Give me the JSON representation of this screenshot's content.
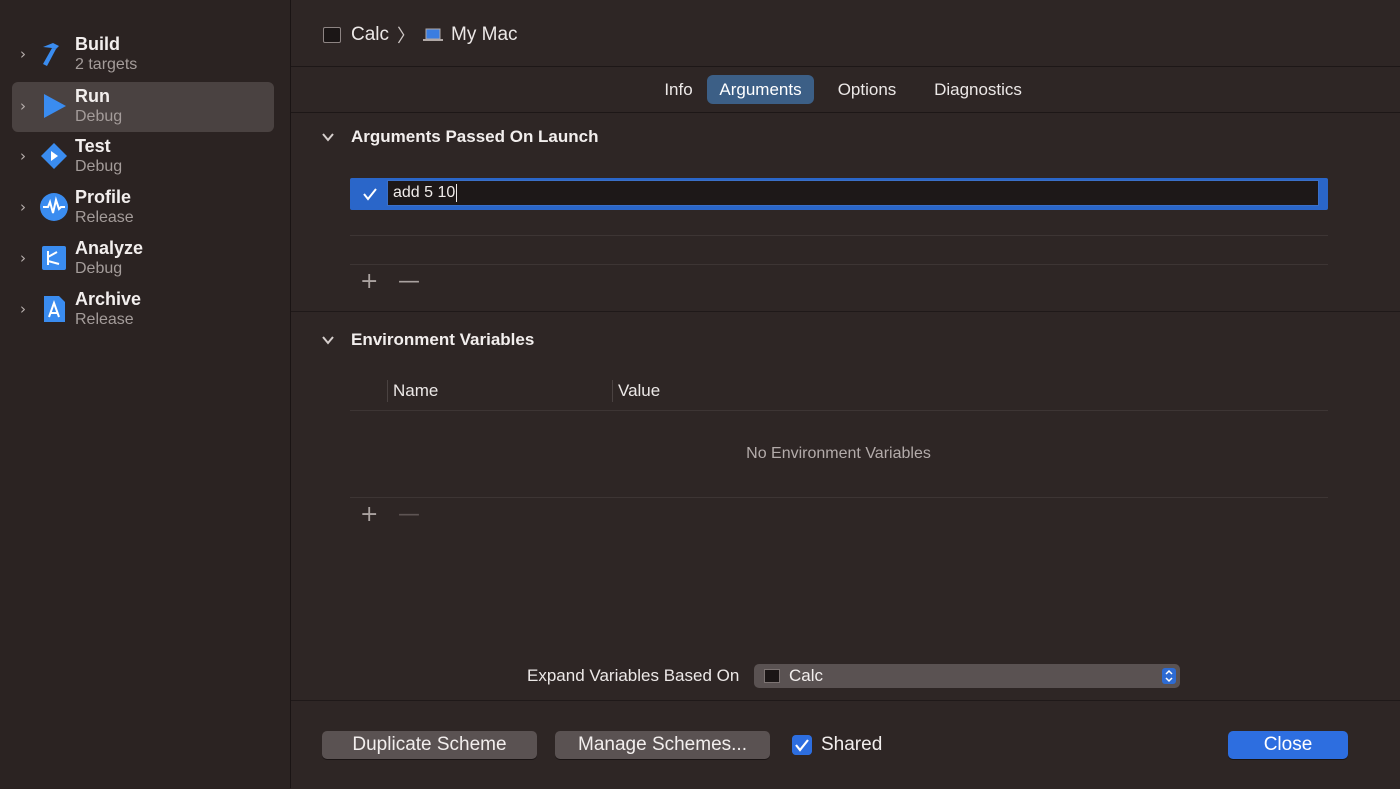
{
  "sidebar": {
    "items": [
      {
        "title": "Build",
        "subtitle": "2 targets",
        "icon": "hammer-icon"
      },
      {
        "title": "Run",
        "subtitle": "Debug",
        "icon": "play-icon",
        "selected": true
      },
      {
        "title": "Test",
        "subtitle": "Debug",
        "icon": "test-diamond-icon"
      },
      {
        "title": "Profile",
        "subtitle": "Release",
        "icon": "waveform-icon"
      },
      {
        "title": "Analyze",
        "subtitle": "Debug",
        "icon": "analyze-icon"
      },
      {
        "title": "Archive",
        "subtitle": "Release",
        "icon": "archive-icon"
      }
    ]
  },
  "breadcrumb": {
    "scheme": "Calc",
    "separator": "〉",
    "destination": "My Mac"
  },
  "tabs": [
    {
      "label": "Info"
    },
    {
      "label": "Arguments",
      "active": true
    },
    {
      "label": "Options"
    },
    {
      "label": "Diagnostics"
    }
  ],
  "arguments_section": {
    "title": "Arguments Passed On Launch",
    "arguments": [
      {
        "value": "add 5 10",
        "enabled": true
      }
    ],
    "add_glyph": "+",
    "remove_glyph": "—"
  },
  "env_section": {
    "title": "Environment Variables",
    "column_name": "Name",
    "column_value": "Value",
    "empty_text": "No Environment Variables",
    "add_glyph": "+",
    "remove_glyph": "—"
  },
  "expand": {
    "label": "Expand Variables Based On",
    "selected": "Calc"
  },
  "footer": {
    "duplicate_label": "Duplicate Scheme",
    "manage_label": "Manage Schemes...",
    "shared_label": "Shared",
    "shared_checked": true,
    "close_label": "Close"
  },
  "colors": {
    "accent": "#2d6ee0",
    "selected_tab": "#3c5f86",
    "background": "#2e2625",
    "sidebar": "#2b2322"
  }
}
